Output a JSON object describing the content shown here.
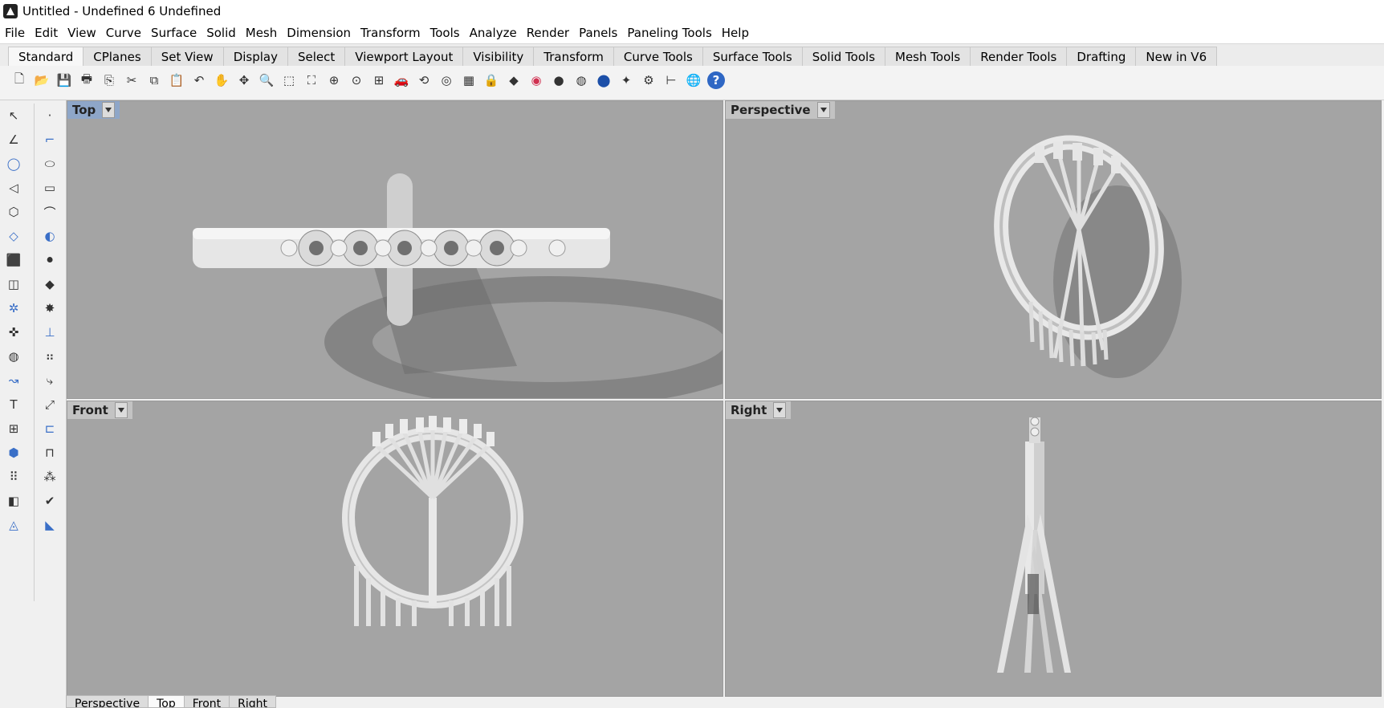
{
  "window": {
    "title": "Untitled - Undefined 6 Undefined"
  },
  "menu": [
    "File",
    "Edit",
    "View",
    "Curve",
    "Surface",
    "Solid",
    "Mesh",
    "Dimension",
    "Transform",
    "Tools",
    "Analyze",
    "Render",
    "Panels",
    "Paneling Tools",
    "Help"
  ],
  "tabs": [
    "Standard",
    "CPlanes",
    "Set View",
    "Display",
    "Select",
    "Viewport Layout",
    "Visibility",
    "Transform",
    "Curve Tools",
    "Surface Tools",
    "Solid Tools",
    "Mesh Tools",
    "Render Tools",
    "Drafting",
    "New in V6"
  ],
  "active_tab": "Standard",
  "toolbar_icons": [
    "new-file",
    "open-file",
    "save",
    "print",
    "import",
    "cut",
    "copy",
    "paste",
    "undo",
    "pan",
    "rotate",
    "zoom",
    "zoom-window",
    "zoom-extents",
    "zoom-selected",
    "zoom-target",
    "4-view",
    "car",
    "rotate-view",
    "camera",
    "cplane",
    "lock",
    "layer",
    "color-wheel",
    "sphere",
    "shaded-sphere",
    "render-sphere",
    "light",
    "gear",
    "dimension",
    "globe",
    "help"
  ],
  "viewports": {
    "top": {
      "label": "Top"
    },
    "perspective": {
      "label": "Perspective"
    },
    "front": {
      "label": "Front"
    },
    "right": {
      "label": "Right"
    }
  },
  "bottom_tabs": [
    "Perspective",
    "Top",
    "Front",
    "Right"
  ]
}
